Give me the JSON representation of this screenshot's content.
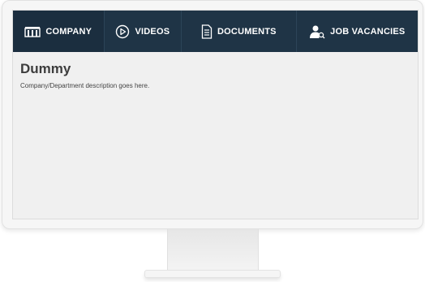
{
  "nav": {
    "tabs": [
      {
        "label": "COMPANY",
        "icon": "building-icon",
        "active": true
      },
      {
        "label": "VIDEOS",
        "icon": "play-circle-icon",
        "active": false
      },
      {
        "label": "DOCUMENTS",
        "icon": "document-icon",
        "active": false
      },
      {
        "label": "JOB VACANCIES",
        "icon": "user-search-icon",
        "active": false
      }
    ]
  },
  "main": {
    "title": "Dummy",
    "description": "Company/Department description goes here."
  },
  "colors": {
    "navbar": "#1f3446",
    "nav_text": "#ffffff",
    "screen_bg": "#f0f0f0",
    "title_text": "#3d3d3d"
  }
}
